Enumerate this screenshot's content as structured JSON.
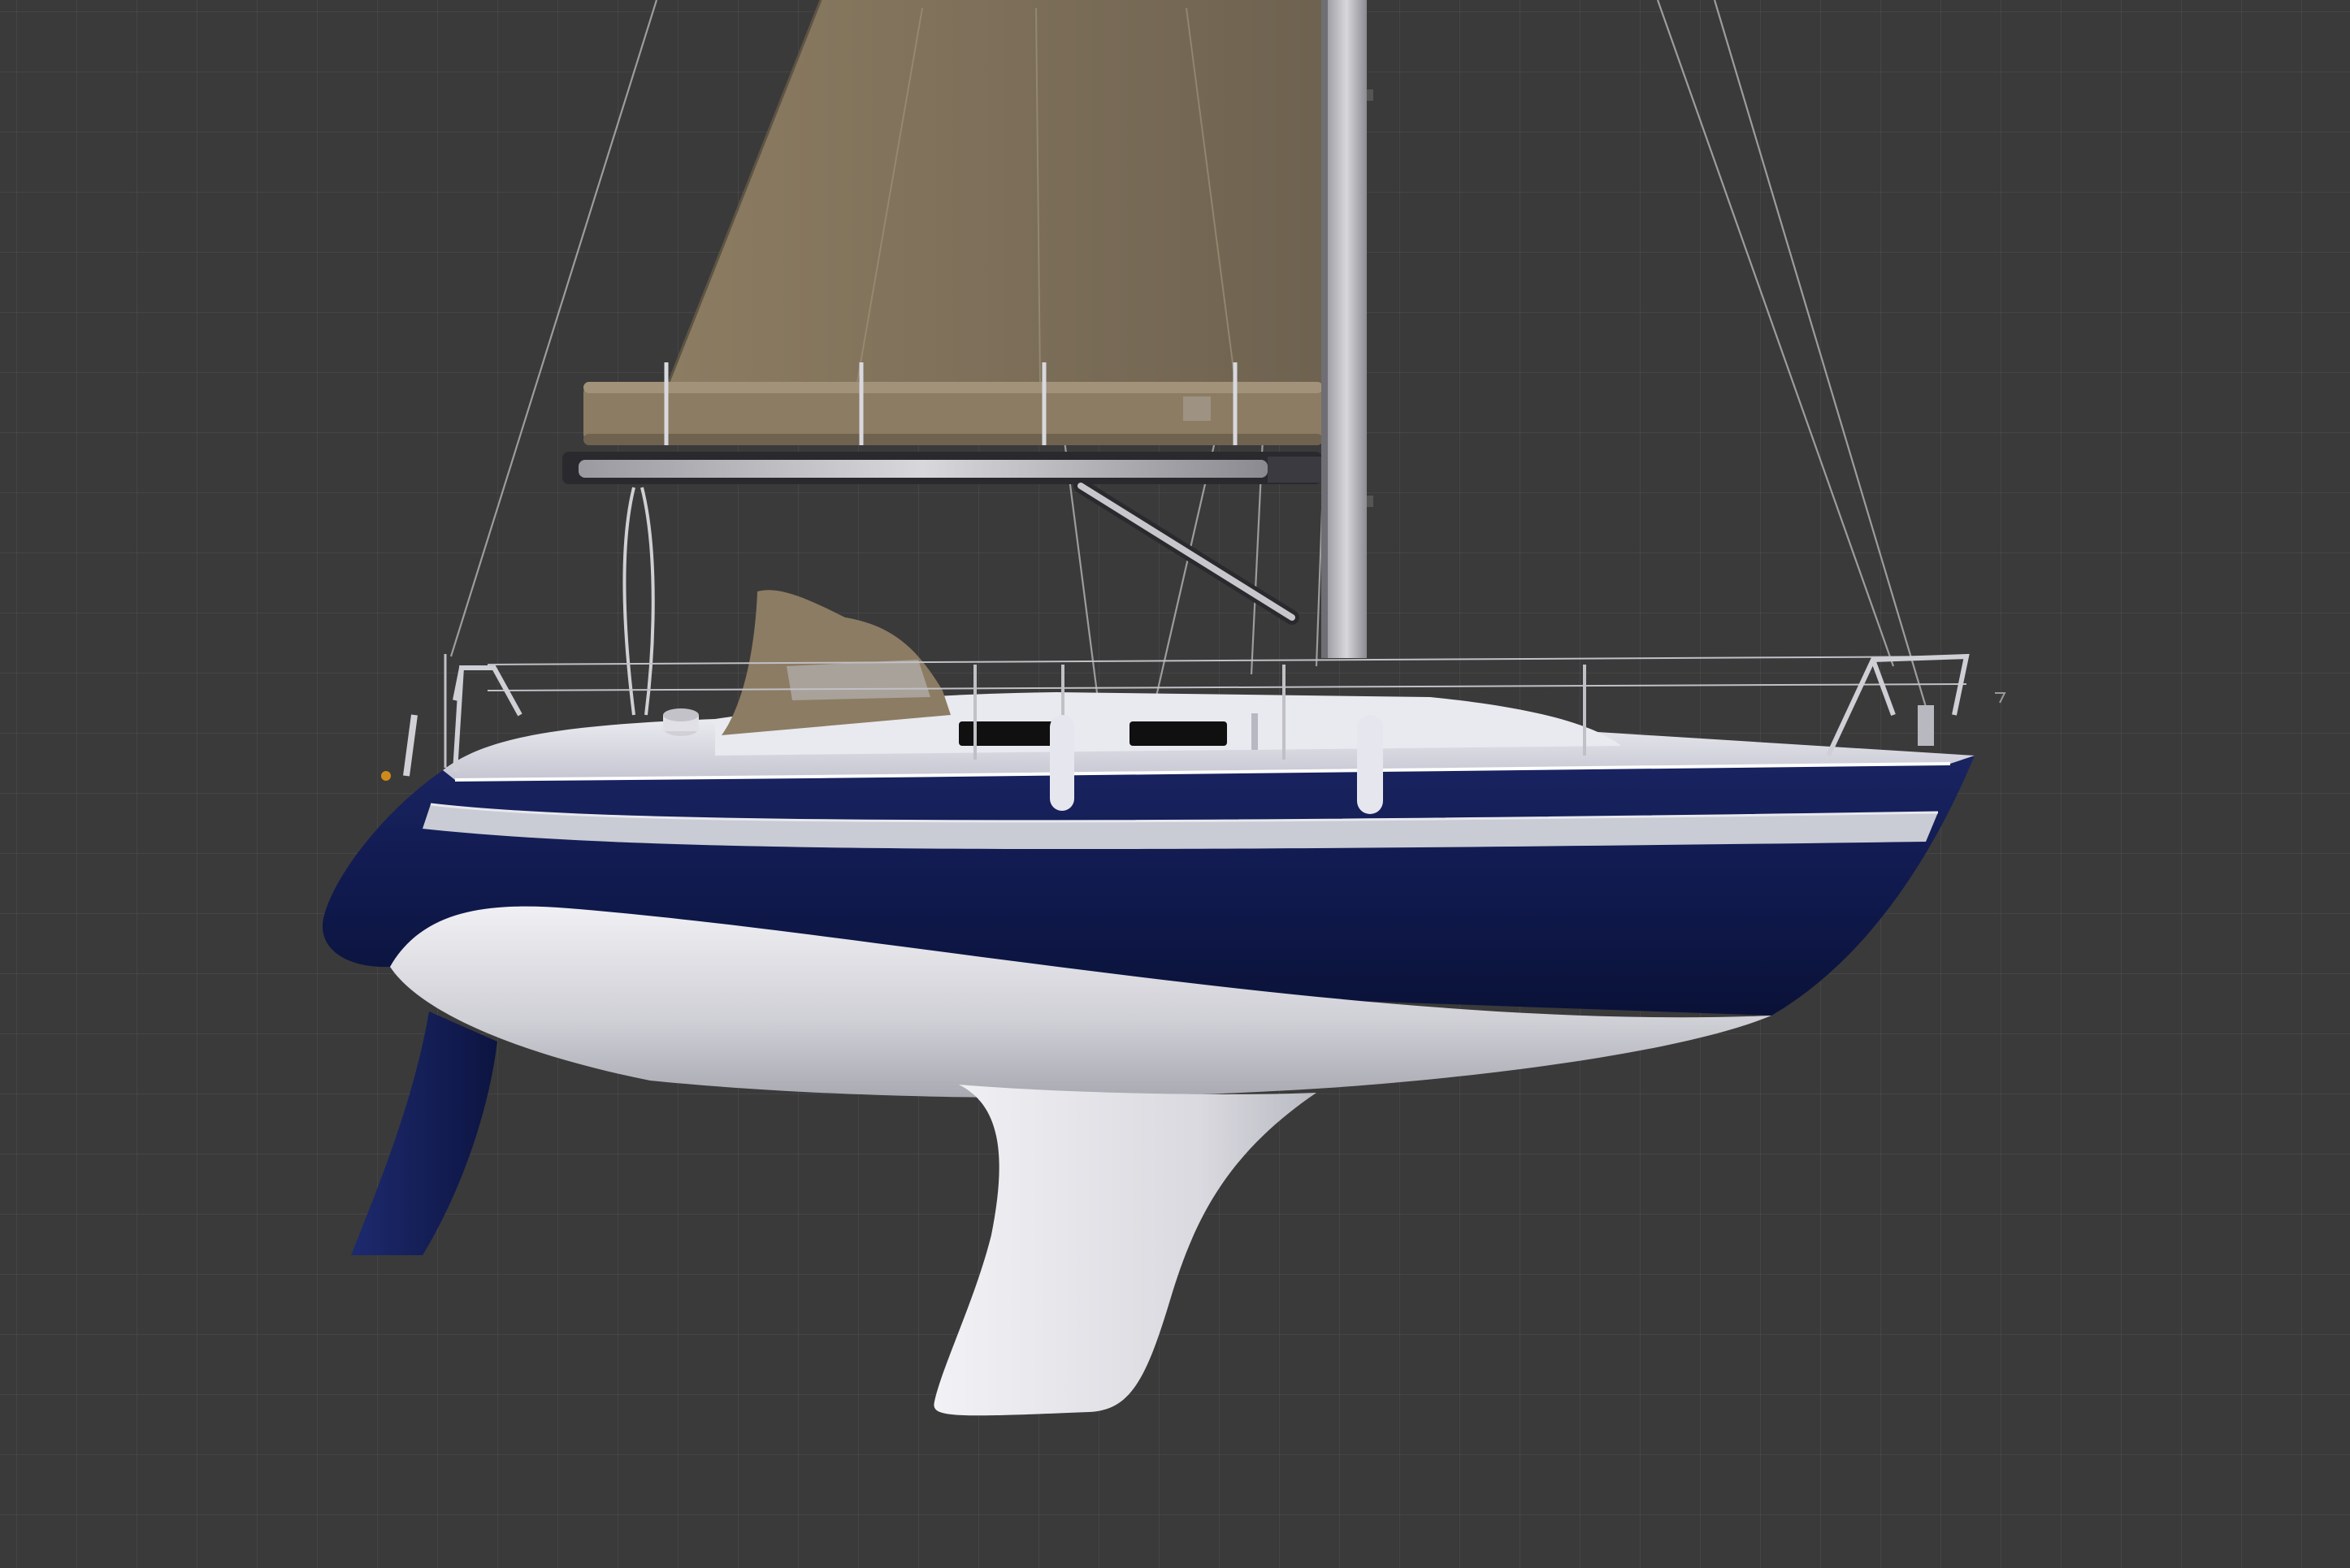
{
  "viewport": {
    "mode": "3D viewport",
    "grid_color": "#4a4a4a",
    "background_color": "#3a3a3a"
  },
  "model": {
    "object": "sailboat",
    "colors": {
      "hull_topsides": "#0c1540",
      "boot_stripe": "#c9ccd4",
      "deck": "#e4e4ec",
      "underbody": "#d8d8de",
      "keel": "#e0e0e6",
      "rudder": "#14205a",
      "sail": "#8a7a62",
      "sail_cover": "#8b7c63",
      "mast": "#c8c8cc",
      "rigging": "#9a9a9a",
      "window": "#101010"
    }
  },
  "icons": {
    "axis": "axis-gizmo-icon"
  }
}
